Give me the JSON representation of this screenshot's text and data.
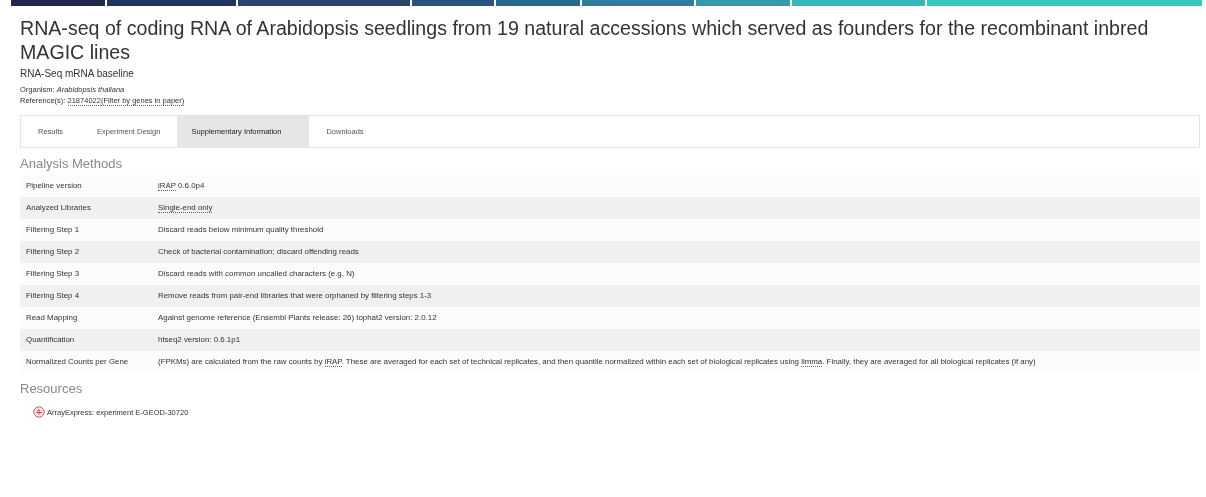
{
  "title": "RNA-seq of coding RNA of Arabidopsis seedlings from 19 natural accessions which served as founders for the recombinant inbred MAGIC lines",
  "subtitle": "RNA-Seq mRNA baseline",
  "organism": {
    "label": "Organism:",
    "value": "Arabidopsis thaliana"
  },
  "references": {
    "label": "Reference(s):",
    "links": [
      "21874022",
      "(Filter by genes in paper)"
    ]
  },
  "tabs": [
    {
      "label": "Results",
      "selected": false
    },
    {
      "label": "Experiment Design",
      "selected": false
    },
    {
      "label": "Supplementary Information",
      "selected": true
    },
    {
      "label": "Downloads",
      "selected": false
    }
  ],
  "analysis_heading": "Analysis Methods",
  "methods": [
    {
      "name": "Pipeline version",
      "value": [
        {
          "text": "iRAP",
          "link": true
        },
        {
          "text": " 0.6.0p4",
          "link": false
        }
      ]
    },
    {
      "name": "Analyzed Libraries",
      "value": [
        {
          "text": "Single-end only",
          "link": true
        }
      ]
    },
    {
      "name": "Filtering Step 1",
      "value": [
        {
          "text": "Discard reads below minimum quality threshold",
          "link": false
        }
      ]
    },
    {
      "name": "Filtering Step 2",
      "value": [
        {
          "text": "Check of bacterial contamination; discard offending reads",
          "link": false
        }
      ]
    },
    {
      "name": "Filtering Step 3",
      "value": [
        {
          "text": "Discard reads with common uncalled characters (e.g. N)",
          "link": false
        }
      ]
    },
    {
      "name": "Filtering Step 4",
      "value": [
        {
          "text": "Remove reads from pair-end libraries that were orphaned by filtering steps 1-3",
          "link": false
        }
      ]
    },
    {
      "name": "Read Mapping",
      "value": [
        {
          "text": "Against genome reference (Ensembl Plants release: 26) tophat2 version: 2.0.12",
          "link": false
        }
      ]
    },
    {
      "name": "Quantification",
      "value": [
        {
          "text": "htseq2 version: 0.6.1p1",
          "link": false
        }
      ]
    },
    {
      "name": "Normalized Counts per Gene",
      "value": [
        {
          "text": "(FPKMs) are calculated from the raw counts by ",
          "link": false
        },
        {
          "text": "iRAP",
          "link": true
        },
        {
          "text": ". These are averaged for each set of technical replicates, and then quantile normalized within each set of biological replicates using ",
          "link": false
        },
        {
          "text": "limma",
          "link": true
        },
        {
          "text": ". Finally, they are averaged for all biological replicates (if any)",
          "link": false
        }
      ]
    }
  ],
  "resources_heading": "Resources",
  "resources": [
    "ArrayExpress: experiment E-GEOD-30720"
  ]
}
